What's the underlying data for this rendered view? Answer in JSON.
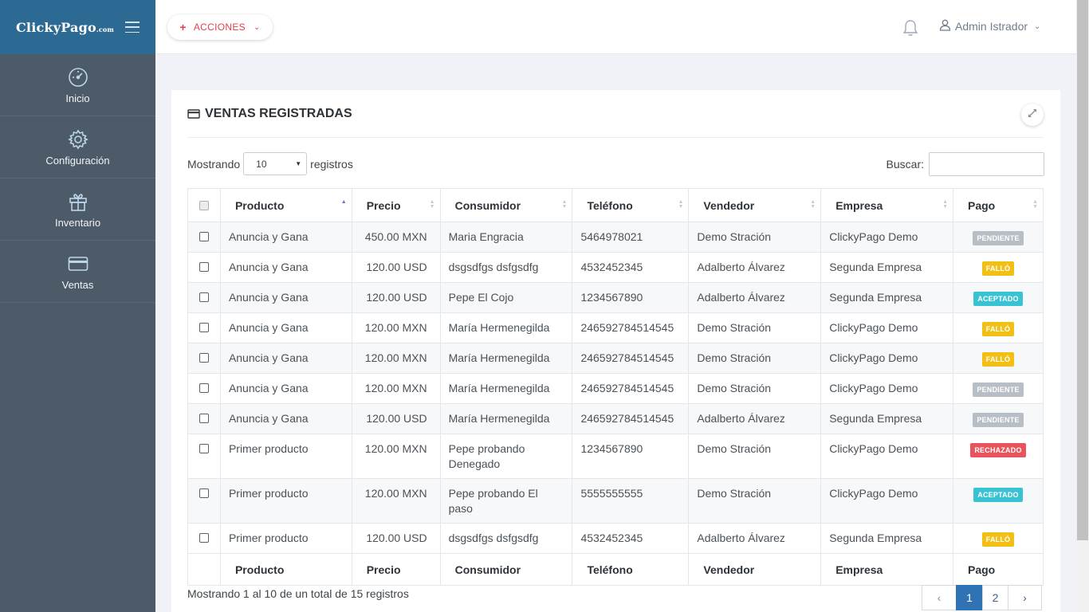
{
  "brand": {
    "name": "ClickyPago",
    "suffix": ".com"
  },
  "sidebar": {
    "items": [
      {
        "label": "Inicio",
        "icon": "speedometer-icon"
      },
      {
        "label": "Configuración",
        "icon": "gear-icon"
      },
      {
        "label": "Inventario",
        "icon": "gift-icon"
      },
      {
        "label": "Ventas",
        "icon": "credit-card-icon"
      }
    ]
  },
  "topbar": {
    "actions_label": "ACCIONES",
    "user_name": "Admin Istrador"
  },
  "card": {
    "title": "VENTAS REGISTRADAS",
    "show_prefix": "Mostrando",
    "show_value": "10",
    "show_suffix": "registros",
    "search_label": "Buscar:",
    "search_value": ""
  },
  "table": {
    "columns": [
      "Producto",
      "Precio",
      "Consumidor",
      "Teléfono",
      "Vendedor",
      "Empresa",
      "Pago"
    ],
    "rows": [
      {
        "producto": "Anuncia y Gana",
        "precio": "450.00 MXN",
        "consumidor": "Maria Engracia",
        "telefono": "5464978021",
        "vendedor": "Demo Stración",
        "empresa": "ClickyPago Demo",
        "pago": "PENDIENTE"
      },
      {
        "producto": "Anuncia y Gana",
        "precio": "120.00 USD",
        "consumidor": "dsgsdfgs dsfgsdfg",
        "telefono": "4532452345",
        "vendedor": "Adalberto Álvarez",
        "empresa": "Segunda Empresa",
        "pago": "FALLÓ"
      },
      {
        "producto": "Anuncia y Gana",
        "precio": "120.00 USD",
        "consumidor": "Pepe El Cojo",
        "telefono": "1234567890",
        "vendedor": "Adalberto Álvarez",
        "empresa": "Segunda Empresa",
        "pago": "ACEPTADO"
      },
      {
        "producto": "Anuncia y Gana",
        "precio": "120.00 MXN",
        "consumidor": "María Hermenegilda",
        "telefono": "246592784514545",
        "vendedor": "Demo Stración",
        "empresa": "ClickyPago Demo",
        "pago": "FALLÓ"
      },
      {
        "producto": "Anuncia y Gana",
        "precio": "120.00 MXN",
        "consumidor": "María Hermenegilda",
        "telefono": "246592784514545",
        "vendedor": "Demo Stración",
        "empresa": "ClickyPago Demo",
        "pago": "FALLÓ"
      },
      {
        "producto": "Anuncia y Gana",
        "precio": "120.00 MXN",
        "consumidor": "María Hermenegilda",
        "telefono": "246592784514545",
        "vendedor": "Demo Stración",
        "empresa": "ClickyPago Demo",
        "pago": "PENDIENTE"
      },
      {
        "producto": "Anuncia y Gana",
        "precio": "120.00 USD",
        "consumidor": "María Hermenegilda",
        "telefono": "246592784514545",
        "vendedor": "Adalberto Álvarez",
        "empresa": "Segunda Empresa",
        "pago": "PENDIENTE"
      },
      {
        "producto": "Primer producto",
        "precio": "120.00 MXN",
        "consumidor": "Pepe probando Denegado",
        "telefono": "1234567890",
        "vendedor": "Demo Stración",
        "empresa": "ClickyPago Demo",
        "pago": "RECHAZADO"
      },
      {
        "producto": "Primer producto",
        "precio": "120.00 MXN",
        "consumidor": "Pepe probando El paso",
        "telefono": "5555555555",
        "vendedor": "Demo Stración",
        "empresa": "ClickyPago Demo",
        "pago": "ACEPTADO"
      },
      {
        "producto": "Primer producto",
        "precio": "120.00 USD",
        "consumidor": "dsgsdfgs dsfgsdfg",
        "telefono": "4532452345",
        "vendedor": "Adalberto Álvarez",
        "empresa": "Segunda Empresa",
        "pago": "FALLÓ"
      }
    ],
    "status_colors": {
      "PENDIENTE": "#b8bec5",
      "FALLÓ": "#f2c014",
      "ACEPTADO": "#39c2d3",
      "RECHAZADO": "#e9545c"
    }
  },
  "footer": {
    "info": "Mostrando 1 al 10 de un total de 15 registros",
    "pages": [
      "1",
      "2"
    ],
    "prev_label": "‹",
    "next_label": "›",
    "current_page": "1"
  },
  "colors": {
    "sidebar": "#4d5a68",
    "brand": "#2c6a94",
    "accent": "#e0414e",
    "page_active": "#2f73b4"
  }
}
